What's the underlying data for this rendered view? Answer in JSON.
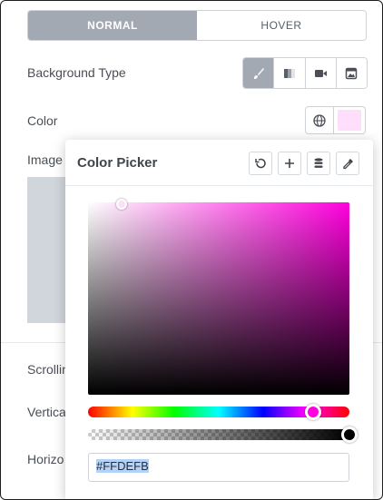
{
  "tabs": [
    {
      "label": "NORMAL",
      "active": true
    },
    {
      "label": "HOVER",
      "active": false
    }
  ],
  "background_type": {
    "label": "Background Type",
    "options": [
      {
        "icon": "brush-icon",
        "active": true
      },
      {
        "icon": "gradient-icon",
        "active": false
      },
      {
        "icon": "video-icon",
        "active": false
      },
      {
        "icon": "slideshow-icon",
        "active": false
      }
    ]
  },
  "color": {
    "label": "Color",
    "swatch": "#FFDEFB",
    "globe_icon": "globe-icon"
  },
  "labels": {
    "image": "Image",
    "scrolling": "Scrolling",
    "vertical": "Vertical",
    "horizontal": "Horizo"
  },
  "picker": {
    "title": "Color Picker",
    "tools": [
      "reset-icon",
      "plus-icon",
      "stack-icon",
      "eyedropper-icon"
    ],
    "hex_value": "#FFDEFB",
    "hue_color": "#ff00dd",
    "hue_position": 0.86,
    "alpha_position": 1.0,
    "saturation": 0.13,
    "brightness": 1.0
  }
}
